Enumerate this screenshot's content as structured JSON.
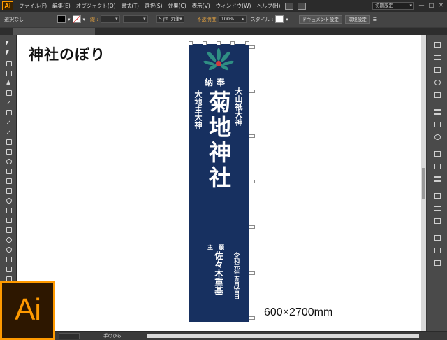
{
  "app": {
    "logo_text": "Ai",
    "menu": [
      "ファイル(F)",
      "編集(E)",
      "オブジェクト(O)",
      "書式(T)",
      "選択(S)",
      "効果(C)",
      "表示(V)",
      "ウィンドウ(W)",
      "ヘルプ(H)"
    ],
    "workspace": "初期設定",
    "window_controls": [
      "—",
      "□",
      "✕"
    ]
  },
  "control_bar": {
    "selection_label": "選択なし",
    "fill_color": "#000000",
    "stroke_label": "線 :",
    "stroke_color": "#ffffff",
    "brush_value": "5 pt. 丸筆",
    "opacity_label": "不透明度",
    "opacity_value": "100%",
    "style_label": "スタイル :",
    "doc_settings_button": "ドキュメント設定",
    "prefs_button": "環境設定"
  },
  "document_tab": {
    "title": ""
  },
  "artwork": {
    "title": "神社のぼり",
    "size_label": "600×2700mm",
    "flag_color": "#173060",
    "nobori": {
      "offering": "納奉",
      "deity_left": "大地主大神",
      "deity_right": "大山祇大神",
      "shrine_name": "菊地神社",
      "ganshu_label": "主願",
      "date": "令和元年五月吉日",
      "donor": "佐々木重基"
    }
  },
  "status_bar": {
    "zoom": "",
    "tool_name": "手のひら"
  },
  "brand": {
    "logo_text": "Ai",
    "accent": "#ff9a00"
  }
}
